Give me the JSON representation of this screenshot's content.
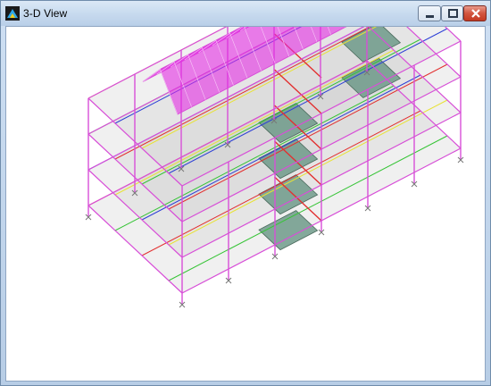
{
  "window": {
    "title": "3-D View",
    "icon": "etabs-app-icon",
    "controls": [
      "minimize-icon",
      "maximize-icon",
      "close-icon"
    ]
  },
  "colors": {
    "frame": "#d84fd8",
    "roof_fill": "#e22be2",
    "slab": "#c9c9c9",
    "shaded_slab": "#6f9a8a",
    "beam_red": "#e23030",
    "beam_blue": "#2c3fd6",
    "beam_green": "#36c436",
    "beam_yellow": "#e8e236"
  }
}
